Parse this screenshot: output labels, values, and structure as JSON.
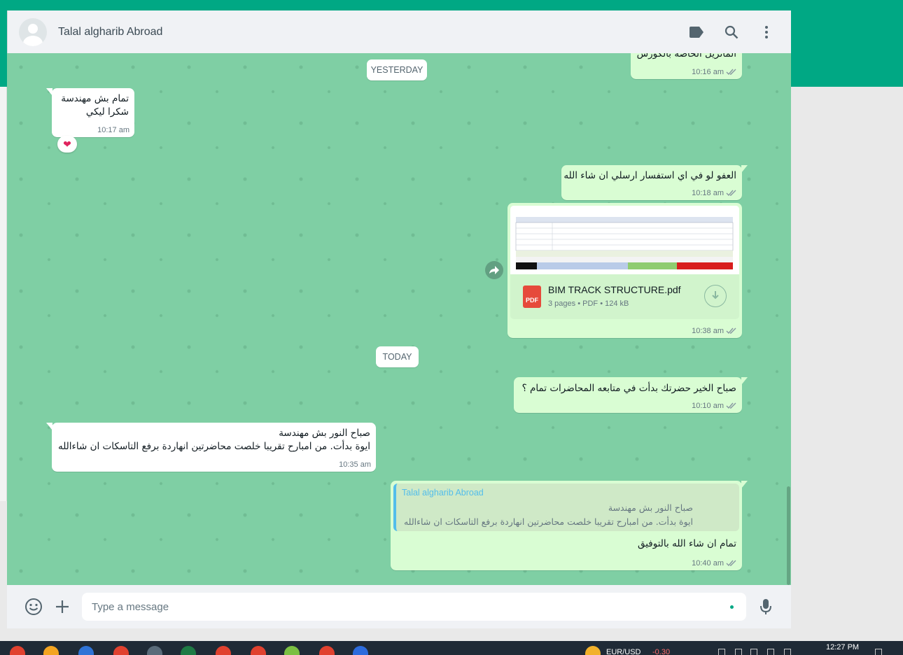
{
  "colors": {
    "brand": "#00a884",
    "chat_background": "#7fcfa4",
    "outgoing_bubble": "#d9fdd3",
    "incoming_bubble": "#ffffff",
    "quote_author": "#53bdeb",
    "reaction": "#e0245e"
  },
  "header": {
    "contact_name": "Talal algharib Abroad",
    "icons": [
      "label-icon",
      "search-icon",
      "menu-dots-icon"
    ]
  },
  "chips": {
    "yesterday": "YESTERDAY",
    "today": "TODAY"
  },
  "messages": [
    {
      "id": "m1",
      "direction": "out",
      "lines": [
        "الماتريل الخاصة بالكورس"
      ],
      "time": "10:16 am",
      "status": "read"
    },
    {
      "id": "m2",
      "direction": "in",
      "lines": [
        "تمام بش مهندسة",
        "شكرا ليكي"
      ],
      "time": "10:17 am",
      "reaction": "❤"
    },
    {
      "id": "m3",
      "direction": "out",
      "lines": [
        "العفو لو في اي استفسار ارسلي ان شاء الله"
      ],
      "time": "10:18 am",
      "status": "read"
    },
    {
      "id": "m4",
      "direction": "out",
      "type": "document",
      "file_name": "BIM TRACK STRUCTURE.pdf",
      "file_icon": "PDF",
      "file_pages": "3 pages",
      "file_type": "PDF",
      "file_size": "124 kB",
      "time": "10:38 am",
      "status": "read"
    },
    {
      "id": "m5",
      "direction": "out",
      "lines": [
        "صباح الخير حضرتك بدأت في متابعه المحاضرات تمام ؟"
      ],
      "time": "10:10 am",
      "status": "read"
    },
    {
      "id": "m6",
      "direction": "in",
      "lines": [
        "صباح النور بش مهندسة",
        "ايوة بدأت. من امبارح تقريبا خلصت محاضرتين انهاردة برفع التاسكات ان شاءالله"
      ],
      "time": "10:35 am"
    },
    {
      "id": "m7",
      "direction": "out",
      "quote_author": "Talal algharib Abroad",
      "quote_lines": [
        "صباح النور بش مهندسة",
        "ايوة بدأت. من امبارح تقريبا خلصت محاضرتين انهاردة برفع التاسكات ان شاءالله"
      ],
      "lines": [
        "تمام ان شاء الله بالتوفيق"
      ],
      "time": "10:40 am",
      "status": "read"
    }
  ],
  "composer": {
    "placeholder": "Type a message",
    "icons": [
      "emoji-icon",
      "attach-plus-icon",
      "microphone-icon"
    ]
  },
  "taskbar": {
    "ticker_symbol": "EUR/USD",
    "ticker_change": "-0.30",
    "clock": "12:27 PM"
  }
}
